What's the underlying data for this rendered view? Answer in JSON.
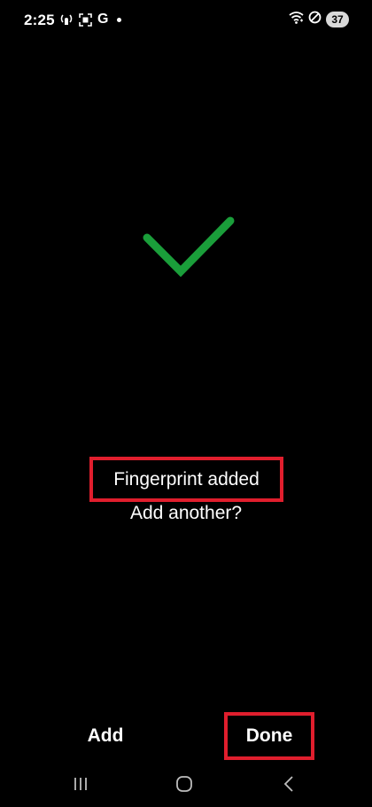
{
  "status_bar": {
    "time": "2:25",
    "carrier_letter": "G",
    "battery_level": "37",
    "icons": [
      "signal-hand-icon",
      "screenshot-icon",
      "google-icon",
      "notification-dot-icon",
      "wifi-icon",
      "do-not-disturb-icon",
      "battery-icon"
    ]
  },
  "result": {
    "icon": "checkmark-icon",
    "icon_color": "#1a9e3a",
    "title": "Fingerprint added",
    "subtitle": "Add another?"
  },
  "actions": {
    "add_label": "Add",
    "done_label": "Done"
  },
  "nav_bar": {
    "icons": [
      "recent-apps-icon",
      "home-icon",
      "back-icon"
    ]
  },
  "highlight_color": "#e01e2d"
}
